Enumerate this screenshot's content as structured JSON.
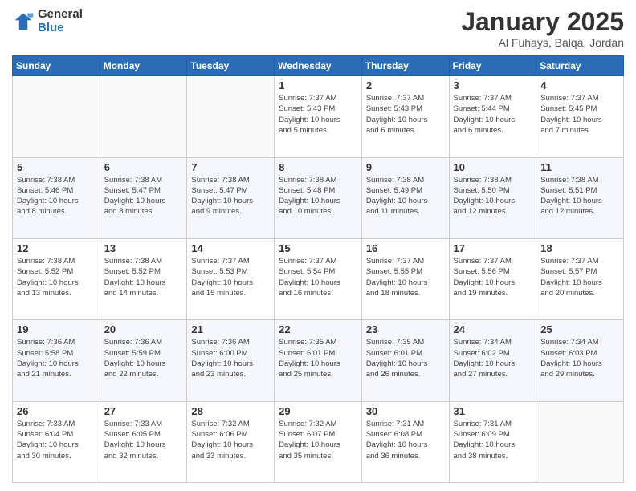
{
  "logo": {
    "line1": "General",
    "line2": "Blue"
  },
  "header": {
    "title": "January 2025",
    "subtitle": "Al Fuhays, Balqa, Jordan"
  },
  "weekdays": [
    "Sunday",
    "Monday",
    "Tuesday",
    "Wednesday",
    "Thursday",
    "Friday",
    "Saturday"
  ],
  "weeks": [
    [
      {
        "day": "",
        "info": ""
      },
      {
        "day": "",
        "info": ""
      },
      {
        "day": "",
        "info": ""
      },
      {
        "day": "1",
        "info": "Sunrise: 7:37 AM\nSunset: 5:43 PM\nDaylight: 10 hours\nand 5 minutes."
      },
      {
        "day": "2",
        "info": "Sunrise: 7:37 AM\nSunset: 5:43 PM\nDaylight: 10 hours\nand 6 minutes."
      },
      {
        "day": "3",
        "info": "Sunrise: 7:37 AM\nSunset: 5:44 PM\nDaylight: 10 hours\nand 6 minutes."
      },
      {
        "day": "4",
        "info": "Sunrise: 7:37 AM\nSunset: 5:45 PM\nDaylight: 10 hours\nand 7 minutes."
      }
    ],
    [
      {
        "day": "5",
        "info": "Sunrise: 7:38 AM\nSunset: 5:46 PM\nDaylight: 10 hours\nand 8 minutes."
      },
      {
        "day": "6",
        "info": "Sunrise: 7:38 AM\nSunset: 5:47 PM\nDaylight: 10 hours\nand 8 minutes."
      },
      {
        "day": "7",
        "info": "Sunrise: 7:38 AM\nSunset: 5:47 PM\nDaylight: 10 hours\nand 9 minutes."
      },
      {
        "day": "8",
        "info": "Sunrise: 7:38 AM\nSunset: 5:48 PM\nDaylight: 10 hours\nand 10 minutes."
      },
      {
        "day": "9",
        "info": "Sunrise: 7:38 AM\nSunset: 5:49 PM\nDaylight: 10 hours\nand 11 minutes."
      },
      {
        "day": "10",
        "info": "Sunrise: 7:38 AM\nSunset: 5:50 PM\nDaylight: 10 hours\nand 12 minutes."
      },
      {
        "day": "11",
        "info": "Sunrise: 7:38 AM\nSunset: 5:51 PM\nDaylight: 10 hours\nand 12 minutes."
      }
    ],
    [
      {
        "day": "12",
        "info": "Sunrise: 7:38 AM\nSunset: 5:52 PM\nDaylight: 10 hours\nand 13 minutes."
      },
      {
        "day": "13",
        "info": "Sunrise: 7:38 AM\nSunset: 5:52 PM\nDaylight: 10 hours\nand 14 minutes."
      },
      {
        "day": "14",
        "info": "Sunrise: 7:37 AM\nSunset: 5:53 PM\nDaylight: 10 hours\nand 15 minutes."
      },
      {
        "day": "15",
        "info": "Sunrise: 7:37 AM\nSunset: 5:54 PM\nDaylight: 10 hours\nand 16 minutes."
      },
      {
        "day": "16",
        "info": "Sunrise: 7:37 AM\nSunset: 5:55 PM\nDaylight: 10 hours\nand 18 minutes."
      },
      {
        "day": "17",
        "info": "Sunrise: 7:37 AM\nSunset: 5:56 PM\nDaylight: 10 hours\nand 19 minutes."
      },
      {
        "day": "18",
        "info": "Sunrise: 7:37 AM\nSunset: 5:57 PM\nDaylight: 10 hours\nand 20 minutes."
      }
    ],
    [
      {
        "day": "19",
        "info": "Sunrise: 7:36 AM\nSunset: 5:58 PM\nDaylight: 10 hours\nand 21 minutes."
      },
      {
        "day": "20",
        "info": "Sunrise: 7:36 AM\nSunset: 5:59 PM\nDaylight: 10 hours\nand 22 minutes."
      },
      {
        "day": "21",
        "info": "Sunrise: 7:36 AM\nSunset: 6:00 PM\nDaylight: 10 hours\nand 23 minutes."
      },
      {
        "day": "22",
        "info": "Sunrise: 7:35 AM\nSunset: 6:01 PM\nDaylight: 10 hours\nand 25 minutes."
      },
      {
        "day": "23",
        "info": "Sunrise: 7:35 AM\nSunset: 6:01 PM\nDaylight: 10 hours\nand 26 minutes."
      },
      {
        "day": "24",
        "info": "Sunrise: 7:34 AM\nSunset: 6:02 PM\nDaylight: 10 hours\nand 27 minutes."
      },
      {
        "day": "25",
        "info": "Sunrise: 7:34 AM\nSunset: 6:03 PM\nDaylight: 10 hours\nand 29 minutes."
      }
    ],
    [
      {
        "day": "26",
        "info": "Sunrise: 7:33 AM\nSunset: 6:04 PM\nDaylight: 10 hours\nand 30 minutes."
      },
      {
        "day": "27",
        "info": "Sunrise: 7:33 AM\nSunset: 6:05 PM\nDaylight: 10 hours\nand 32 minutes."
      },
      {
        "day": "28",
        "info": "Sunrise: 7:32 AM\nSunset: 6:06 PM\nDaylight: 10 hours\nand 33 minutes."
      },
      {
        "day": "29",
        "info": "Sunrise: 7:32 AM\nSunset: 6:07 PM\nDaylight: 10 hours\nand 35 minutes."
      },
      {
        "day": "30",
        "info": "Sunrise: 7:31 AM\nSunset: 6:08 PM\nDaylight: 10 hours\nand 36 minutes."
      },
      {
        "day": "31",
        "info": "Sunrise: 7:31 AM\nSunset: 6:09 PM\nDaylight: 10 hours\nand 38 minutes."
      },
      {
        "day": "",
        "info": ""
      }
    ]
  ]
}
